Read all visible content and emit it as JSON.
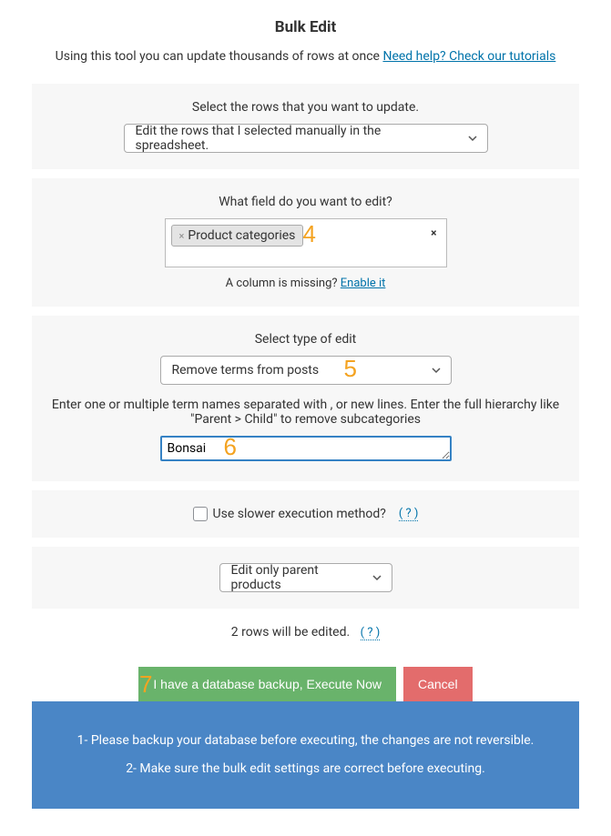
{
  "header": {
    "title": "Bulk Edit",
    "subtitle_prefix": "Using this tool you can update thousands of rows at once ",
    "subtitle_link": "Need help? Check our tutorials"
  },
  "rows_select": {
    "label": "Select the rows that you want to update.",
    "value": "Edit the rows that I selected manually in the spreadsheet."
  },
  "field_select": {
    "label": "What field do you want to edit?",
    "chip": "Product categories",
    "missing_prefix": "A column is missing? ",
    "missing_link": "Enable it"
  },
  "edit_type": {
    "label": "Select type of edit",
    "value": "Remove terms from posts",
    "instructions": "Enter one or multiple term names separated with , or new lines. Enter the full hierarchy like \"Parent > Child\" to remove subcategories",
    "term_value": "Bonsai"
  },
  "slower": {
    "label": "Use slower execution method?",
    "help": "( ? )"
  },
  "scope": {
    "value": "Edit only parent products"
  },
  "summary": {
    "text": "2 rows will be edited.",
    "help": "( ? )"
  },
  "actions": {
    "execute": "I have a database backup, Execute Now",
    "cancel": "Cancel"
  },
  "notice": {
    "line1": "1- Please backup your database before executing, the changes are not reversible.",
    "line2": "2- Make sure the bulk edit settings are correct before executing."
  },
  "annotations": {
    "a4": "4",
    "a5": "5",
    "a6": "6",
    "a7": "7"
  }
}
